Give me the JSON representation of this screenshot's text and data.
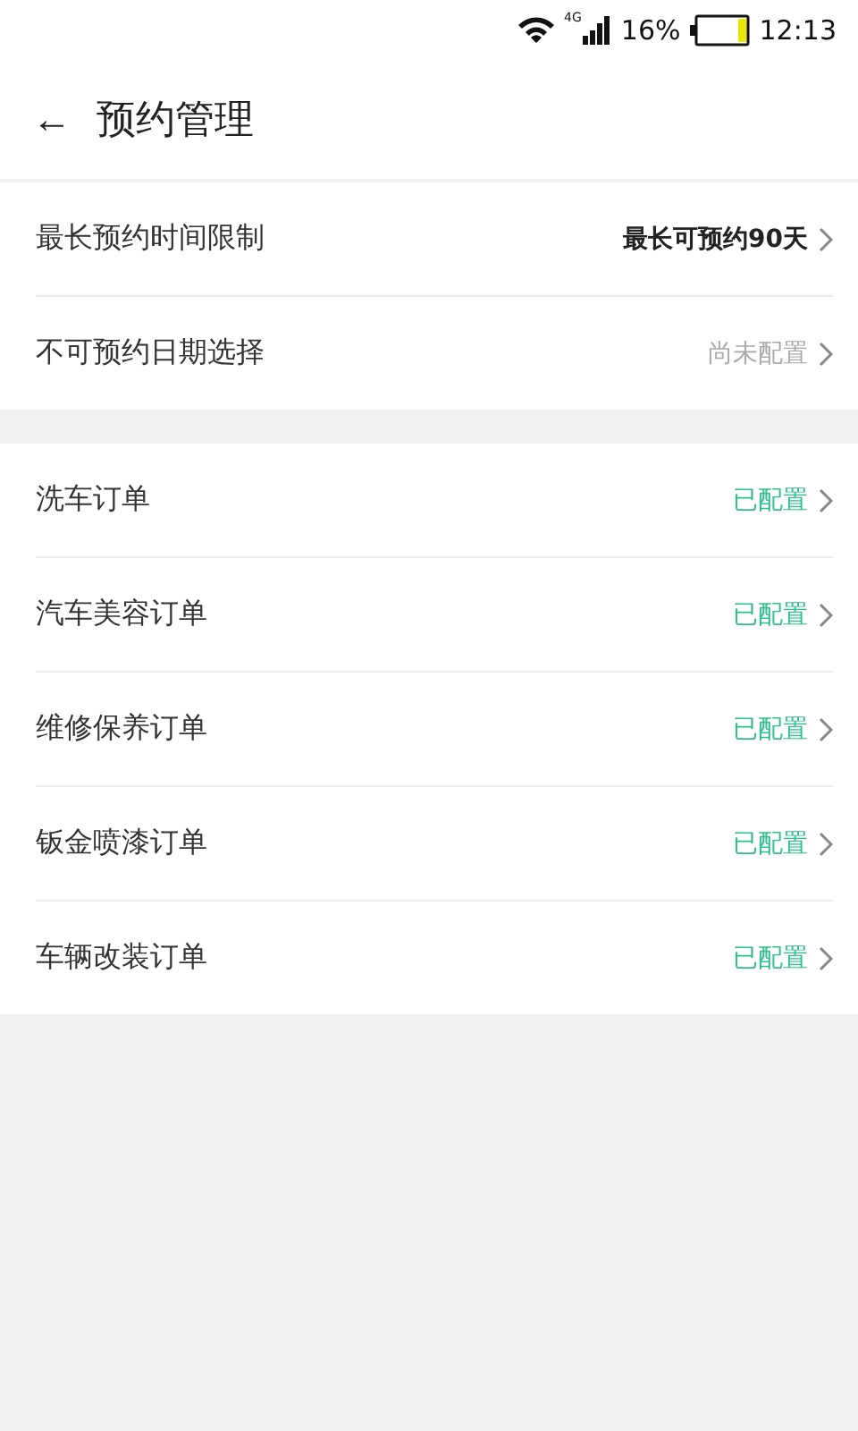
{
  "status_bar": {
    "network": "4G",
    "battery": "16%",
    "time": "12:13"
  },
  "header": {
    "back": "←",
    "title": "预约管理"
  },
  "sections": [
    {
      "rows": [
        {
          "label": "最长预约时间限制",
          "value": "最长可预约90天",
          "kind": "set"
        },
        {
          "label": "不可预约日期选择",
          "value": "尚未配置",
          "kind": "unset"
        }
      ]
    },
    {
      "rows": [
        {
          "label": "洗车订单",
          "value": "已配置",
          "kind": "configured"
        },
        {
          "label": "汽车美容订单",
          "value": "已配置",
          "kind": "configured"
        },
        {
          "label": "维修保养订单",
          "value": "已配置",
          "kind": "configured"
        },
        {
          "label": "钣金喷漆订单",
          "value": "已配置",
          "kind": "configured"
        },
        {
          "label": "车辆改装订单",
          "value": "已配置",
          "kind": "configured"
        }
      ]
    }
  ]
}
